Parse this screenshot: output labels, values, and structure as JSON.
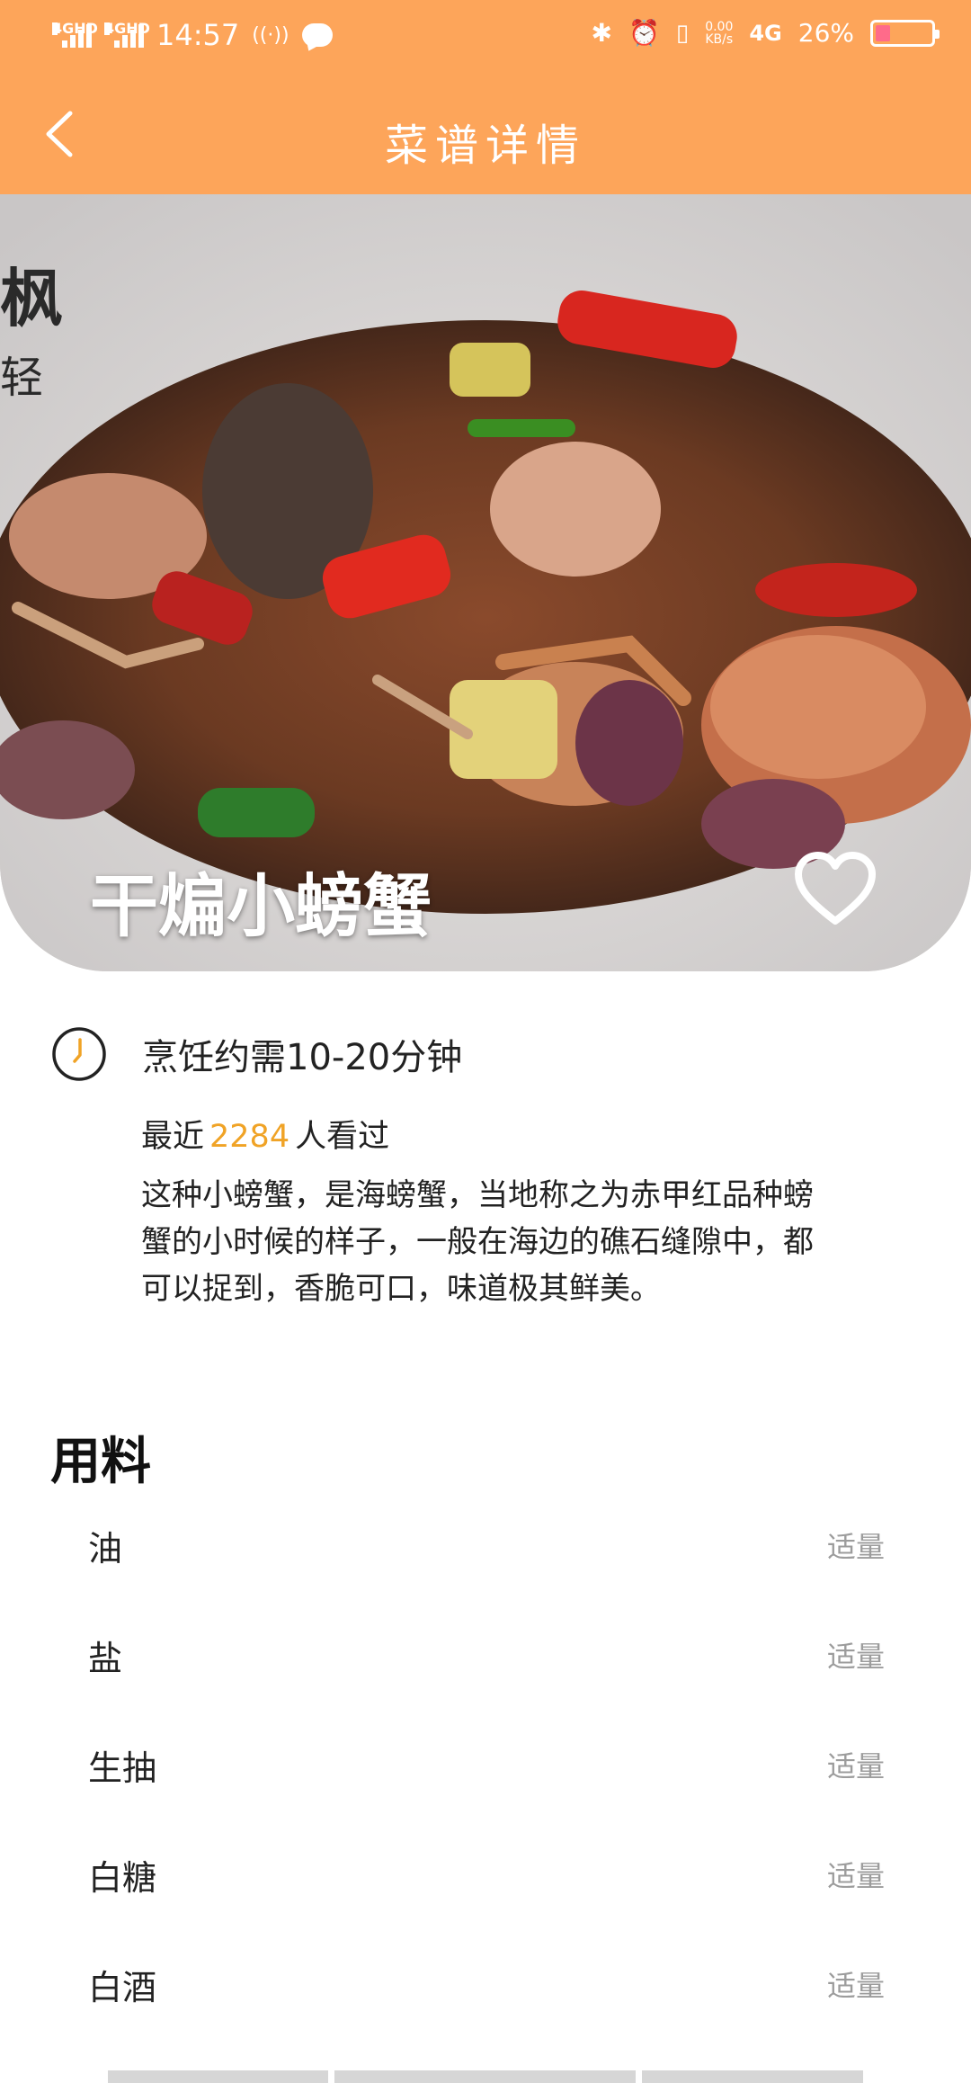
{
  "status_bar": {
    "network1": "4GHD",
    "network2": "4GHD",
    "time": "14:57",
    "speed_value": "0.00",
    "speed_unit": "KB/s",
    "network3": "4G",
    "battery": "26%",
    "battery_level": 0.26
  },
  "header": {
    "title": "菜谱详情",
    "back_icon": "chevron-left-icon"
  },
  "recipe": {
    "name": "干煸小螃蟹",
    "favorite_icon": "heart-outline-icon",
    "cook_time": "烹饪约需10-20分钟",
    "views_prefix": "最近",
    "views_count": "2284",
    "views_suffix": "人看过",
    "description": "这种小螃蟹，是海螃蟹，当地称之为赤甲红品种螃蟹的小时候的样子，一般在海边的礁石缝隙中，都可以捉到，香脆可口，味道极其鲜美。"
  },
  "ingredients": {
    "title": "用料",
    "items": [
      {
        "name": "油",
        "amount": "适量"
      },
      {
        "name": "盐",
        "amount": "适量"
      },
      {
        "name": "生抽",
        "amount": "适量"
      },
      {
        "name": "白糖",
        "amount": "适量"
      },
      {
        "name": "白酒",
        "amount": "适量"
      }
    ]
  },
  "colors": {
    "accent": "#fda55a",
    "highlight": "#f0a326",
    "muted": "#9c9c9c"
  }
}
